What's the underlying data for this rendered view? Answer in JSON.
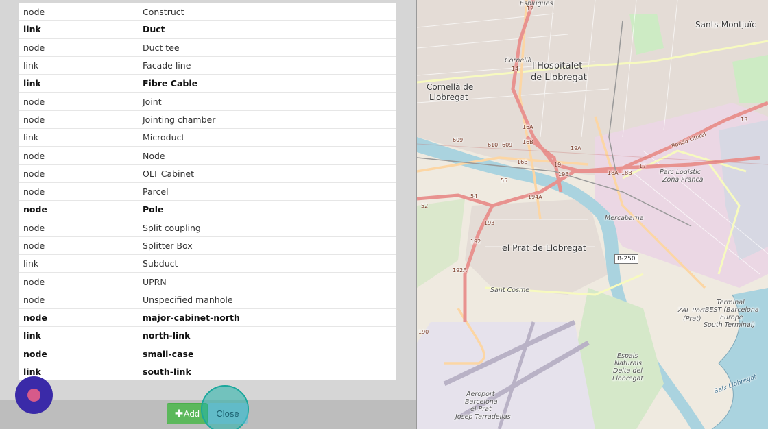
{
  "layer_table": {
    "rows": [
      {
        "type": "node",
        "name": "Construct",
        "bold": false
      },
      {
        "type": "link",
        "name": "Duct",
        "bold": true
      },
      {
        "type": "node",
        "name": "Duct tee",
        "bold": false
      },
      {
        "type": "link",
        "name": "Facade line",
        "bold": false
      },
      {
        "type": "link",
        "name": "Fibre Cable",
        "bold": true
      },
      {
        "type": "node",
        "name": "Joint",
        "bold": false
      },
      {
        "type": "node",
        "name": "Jointing chamber",
        "bold": false
      },
      {
        "type": "link",
        "name": "Microduct",
        "bold": false
      },
      {
        "type": "node",
        "name": "Node",
        "bold": false
      },
      {
        "type": "node",
        "name": "OLT Cabinet",
        "bold": false
      },
      {
        "type": "node",
        "name": "Parcel",
        "bold": false
      },
      {
        "type": "node",
        "name": "Pole",
        "bold": true
      },
      {
        "type": "node",
        "name": "Split coupling",
        "bold": false
      },
      {
        "type": "node",
        "name": "Splitter Box",
        "bold": false
      },
      {
        "type": "link",
        "name": "Subduct",
        "bold": false
      },
      {
        "type": "node",
        "name": "UPRN",
        "bold": false
      },
      {
        "type": "node",
        "name": "Unspecified manhole",
        "bold": false
      },
      {
        "type": "node",
        "name": "major-cabinet-north",
        "bold": true
      },
      {
        "type": "link",
        "name": "north-link",
        "bold": true
      },
      {
        "type": "node",
        "name": "small-case",
        "bold": true
      },
      {
        "type": "link",
        "name": "south-link",
        "bold": true
      }
    ]
  },
  "footer": {
    "add_icon": "plus-icon",
    "add_label": "Add",
    "close_label": "Close"
  },
  "map": {
    "labels": {
      "esplugues": "Esplugues",
      "sants": "Sants-Montjuïc",
      "hospitalet_1": "l'Hospitalet",
      "hospitalet_2": "de Llobregat",
      "cornella_1": "Cornellà de",
      "cornella_2": "Llobregat",
      "cornella_small": "Cornellà",
      "parc_1": "Parc Logístic",
      "parc_2": "Zona Franca",
      "mercabarna": "Mercabarna",
      "prat": "el Prat de Llobregat",
      "sant_cosme": "Sant Cosme",
      "zal_1": "ZAL Port",
      "zal_2": "(Prat)",
      "terminal_1": "Terminal",
      "terminal_2": "BEST (Barcelona",
      "terminal_3": "Europe",
      "terminal_4": "South Terminal)",
      "espais_1": "Espais",
      "espais_2": "Naturals",
      "espais_3": "Delta del",
      "espais_4": "Llobregat",
      "aeroport_1": "Aeroport",
      "aeroport_2": "Barcelona",
      "aeroport_3": "el Prat",
      "aeroport_4": "Josep Tarradellas",
      "baix": "Baix Llobregat",
      "ronda": "Ronda Litoral",
      "b250": "B-250",
      "r12": "12",
      "r13": "13",
      "r14": "14",
      "r16a": "16A",
      "r16b": "16B",
      "r16b2": "16B",
      "r19": "19",
      "r19a": "19A",
      "r19b": "19B",
      "r18a": "18A",
      "r18b": "18B",
      "r17": "17",
      "r609": "609",
      "r610": "610",
      "r609b": "609",
      "r55": "55",
      "r54": "54",
      "r52": "52",
      "r194a": "194A",
      "r193": "193",
      "r192": "192",
      "r192a": "192A",
      "r190": "190"
    },
    "colors": {
      "land": "#efeae0",
      "urban": "#e2d8d3",
      "industrial": "#ebd9e6",
      "park": "#cdebc4",
      "water": "#aad3df",
      "motorway": "#e8928f",
      "primary": "#fcd6a4",
      "secondary": "#f7fabf",
      "airport": "#e6e2ec"
    }
  }
}
